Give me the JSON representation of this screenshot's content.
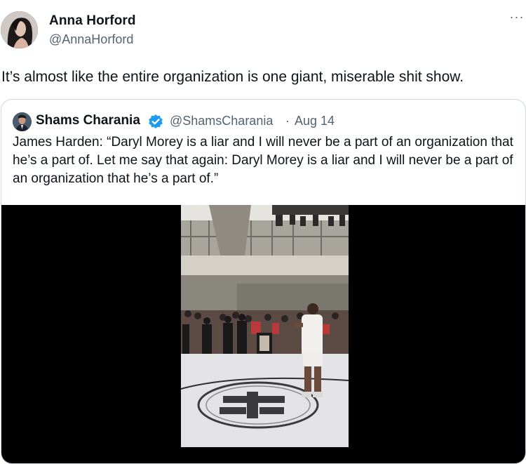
{
  "tweet": {
    "author_name": "Anna Horford",
    "author_handle": "@AnnaHorford",
    "more_icon": "more-horizontal-icon",
    "more_glyph": "···",
    "text": "It’s almost like the entire organization is one giant, miserable shit show."
  },
  "quote": {
    "author_name": "Shams Charania",
    "verified_icon": "verified-badge-icon",
    "author_handle": "@ShamsCharania",
    "separator": "·",
    "date": "Aug 14",
    "text": "James Harden: “Daryl Morey is a liar and I will never be a part of an organization that he’s a part of. Let me say that again: Daryl Morey is a liar and I will never be a part of an organization that he’s a part of.”"
  },
  "colors": {
    "text_primary": "#0f1419",
    "text_secondary": "#536471",
    "border": "#cfd9de",
    "verified_blue": "#1d9bf0",
    "video_bg": "#000000"
  }
}
